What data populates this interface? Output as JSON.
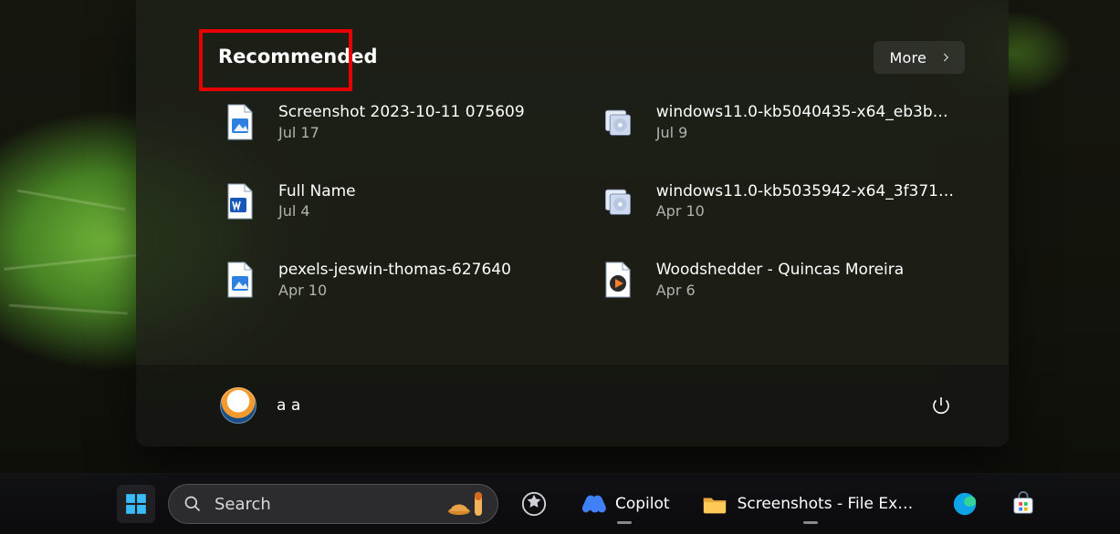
{
  "start_menu": {
    "recommended_title": "Recommended",
    "more_label": "More",
    "items": [
      {
        "name": "Screenshot 2023-10-11 075609",
        "date": "Jul 17",
        "icon": "image-file"
      },
      {
        "name": "windows11.0-kb5040435-x64_eb3b…",
        "date": "Jul 9",
        "icon": "msu-file"
      },
      {
        "name": "Full Name",
        "date": "Jul 4",
        "icon": "word-file"
      },
      {
        "name": "windows11.0-kb5035942-x64_3f371…",
        "date": "Apr 10",
        "icon": "msu-file"
      },
      {
        "name": "pexels-jeswin-thomas-627640",
        "date": "Apr 10",
        "icon": "image-file"
      },
      {
        "name": "Woodshedder - Quincas Moreira",
        "date": "Apr 6",
        "icon": "video-file"
      }
    ],
    "account": {
      "name": "a a"
    }
  },
  "taskbar": {
    "search_placeholder": "Search",
    "items": [
      {
        "label": "",
        "icon": "widgets",
        "active": false
      },
      {
        "label": "Copilot",
        "icon": "copilot",
        "active": true
      },
      {
        "label": "Screenshots - File Explo",
        "icon": "folder",
        "active": true
      },
      {
        "label": "",
        "icon": "edge",
        "active": false
      },
      {
        "label": "",
        "icon": "store",
        "active": false
      }
    ]
  }
}
